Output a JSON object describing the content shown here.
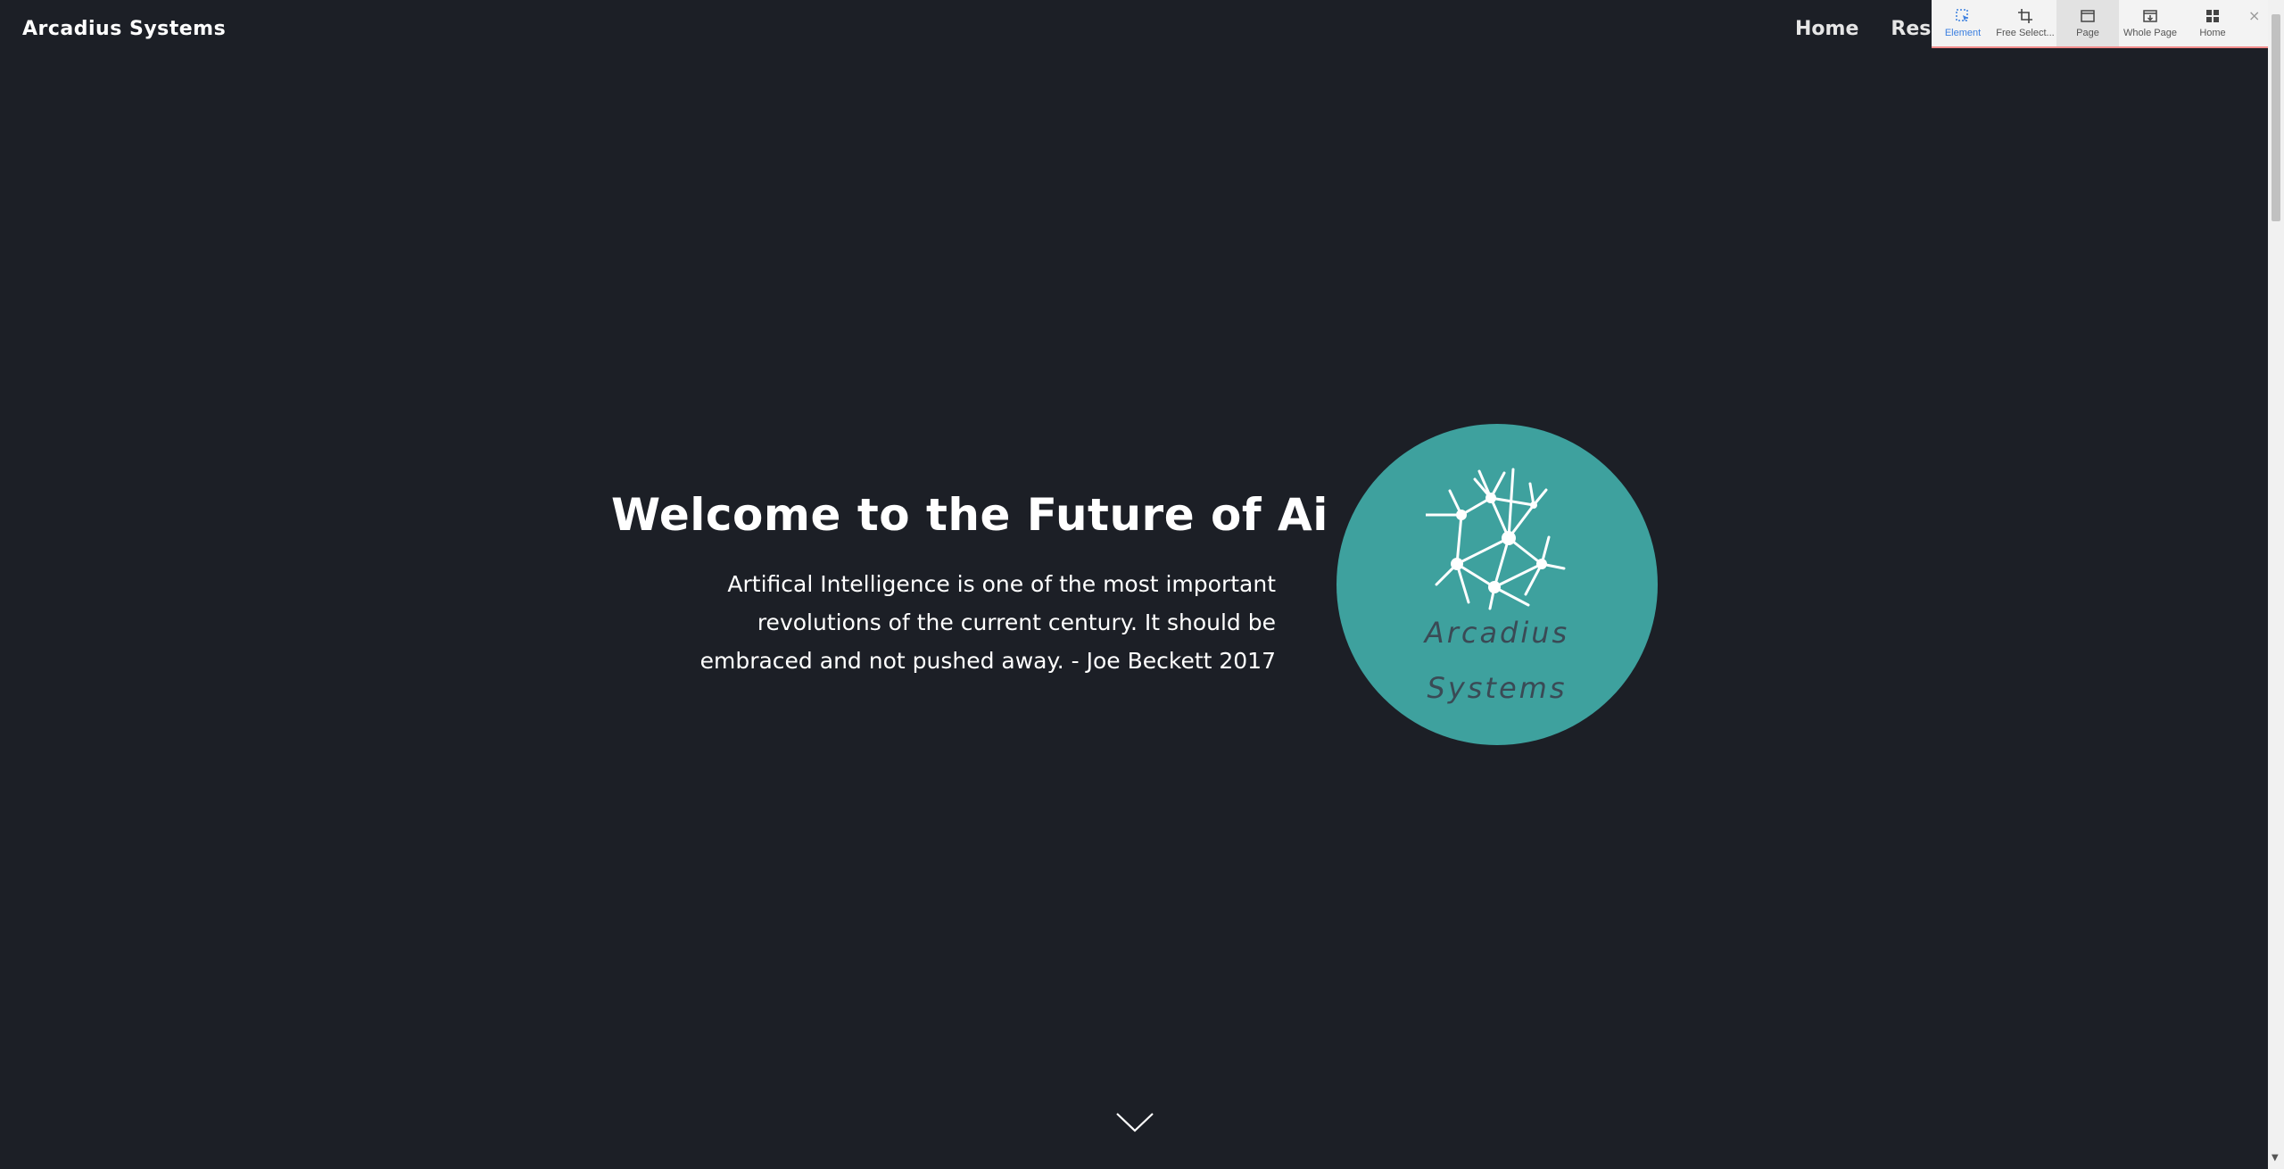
{
  "navbar": {
    "brand": "Arcadius Systems",
    "links": [
      "Home",
      "Rese"
    ]
  },
  "toolbar": {
    "buttons": [
      {
        "label": "Element",
        "icon": "element-select-icon",
        "selected": true
      },
      {
        "label": "Free Select...",
        "icon": "crop-icon",
        "selected": false
      },
      {
        "label": "Page",
        "icon": "page-icon",
        "selected": false
      },
      {
        "label": "Whole Page",
        "icon": "whole-page-icon",
        "selected": false
      },
      {
        "label": "Home",
        "icon": "grid-icon",
        "selected": false
      }
    ],
    "close": "×"
  },
  "hero": {
    "title": "Welcome to the Future of Ai",
    "quote_lines": [
      "Artifical Intelligence is one of the most important",
      "revolutions of the current century. It should be",
      "embraced and not pushed away. - Joe Beckett 2017"
    ]
  },
  "logo": {
    "line1": "Arcadius",
    "line2": "Systems"
  },
  "colors": {
    "background": "#1c1f26",
    "accent_teal": "#3ea19e",
    "logo_text": "#3a4a55"
  }
}
